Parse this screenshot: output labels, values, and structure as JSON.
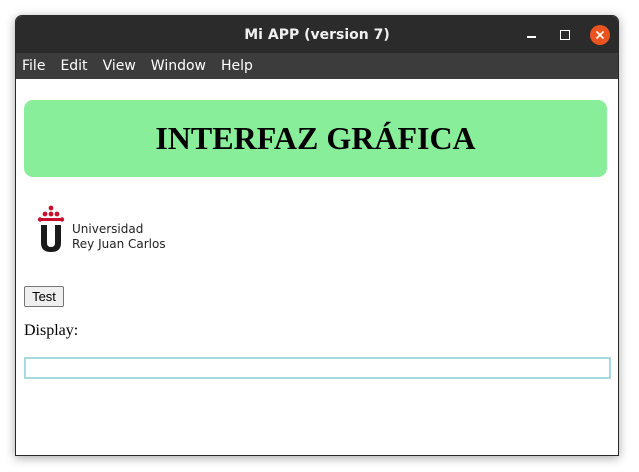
{
  "window": {
    "title": "Mi APP (version 7)",
    "controls": [
      "minimize-icon",
      "maximize-icon",
      "close-icon"
    ],
    "close_color": "#e95420"
  },
  "menubar": {
    "items": [
      {
        "label": "File"
      },
      {
        "label": "Edit"
      },
      {
        "label": "View"
      },
      {
        "label": "Window"
      },
      {
        "label": "Help"
      }
    ]
  },
  "banner": {
    "title": "INTERFAZ GRÁFICA",
    "background": "#88ee99"
  },
  "logo": {
    "line1": "Universidad",
    "line2": "Rey Juan Carlos",
    "accent": "#c8102e"
  },
  "test_button": {
    "label": "Test"
  },
  "display": {
    "label": "Display:",
    "value": "",
    "border_color": "#a8d8e0"
  }
}
